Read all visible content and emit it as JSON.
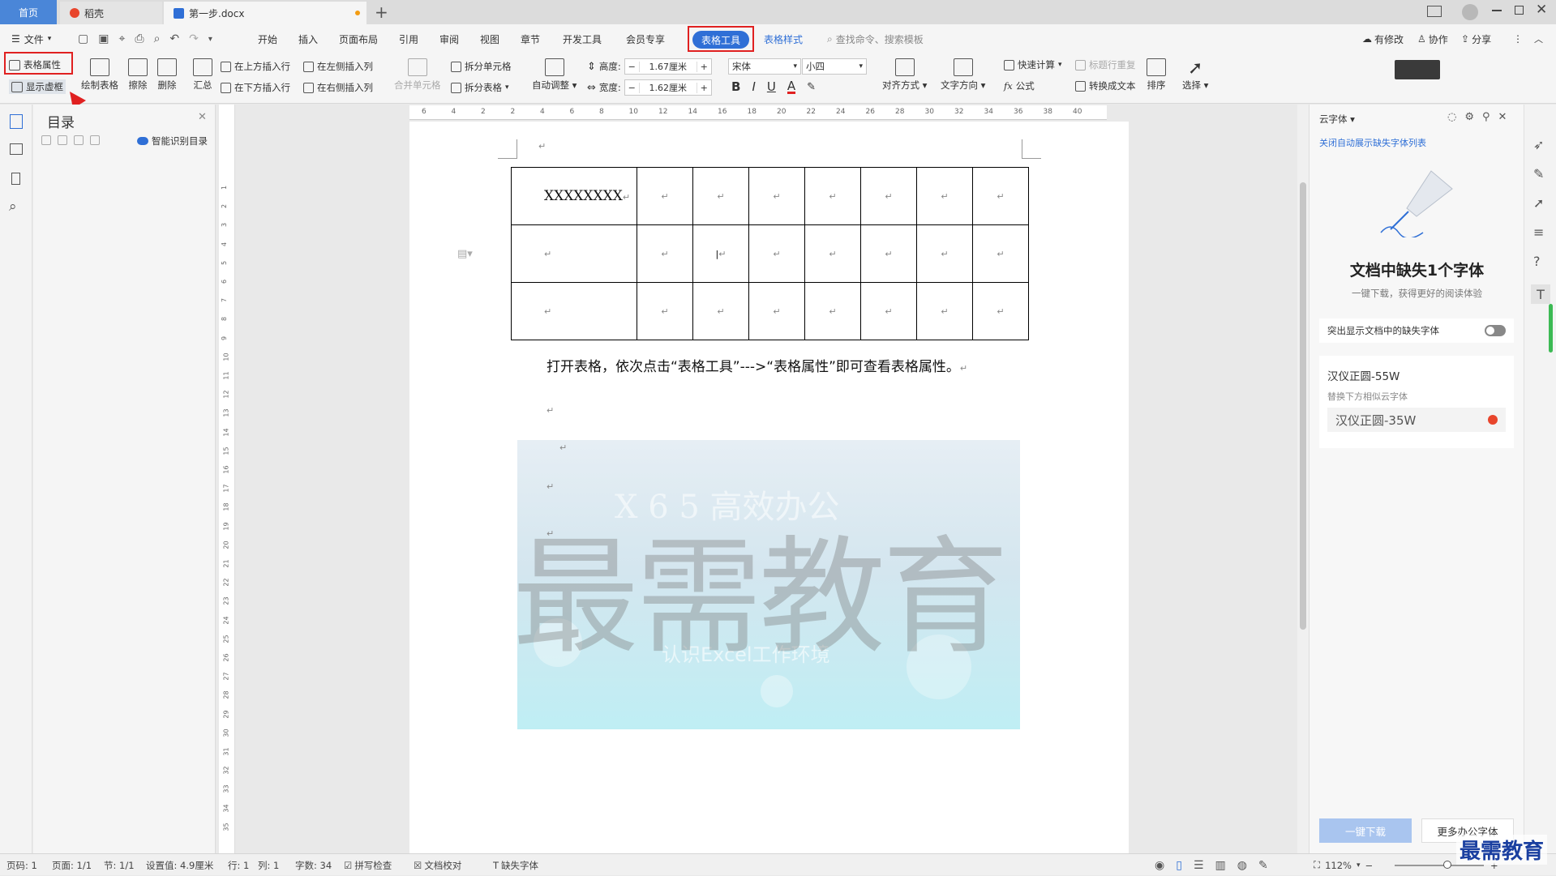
{
  "tabs": {
    "home": "首页",
    "t2": "稻壳",
    "t3": "第一步.docx",
    "add": "+"
  },
  "menu": {
    "file": "文件",
    "items": [
      "开始",
      "插入",
      "页面布局",
      "引用",
      "审阅",
      "视图",
      "章节",
      "开发工具",
      "会员专享"
    ],
    "active": "表格工具",
    "style": "表格样式",
    "search": "查找命令、搜索模板",
    "right": [
      "有修改",
      "协作",
      "分享"
    ]
  },
  "ribbon": {
    "table_props": "表格属性",
    "show_grid": "显示虚框",
    "draw": "绘制表格",
    "erase": "擦除",
    "delete": "删除",
    "sum": "汇总",
    "ins_above": "在上方插入行",
    "ins_left": "在左侧插入列",
    "ins_below": "在下方插入行",
    "ins_right": "在右侧插入列",
    "merge": "合并单元格",
    "split_cell": "拆分单元格",
    "split_table": "拆分表格",
    "auto_fit": "自动调整",
    "height_label": "高度:",
    "height_val": "1.67厘米",
    "width_label": "宽度:",
    "width_val": "1.62厘米",
    "font": "宋体",
    "size": "小四",
    "bold": "B",
    "italic": "I",
    "underline": "U",
    "fontcolor": "A",
    "align": "对齐方式",
    "text_dir": "文字方向",
    "quick_calc": "快速计算",
    "repeat_title": "标题行重复",
    "formula": "公式",
    "to_text": "转换成文本",
    "sort": "排序",
    "select": "选择"
  },
  "toc": {
    "title": "目录",
    "smart": "智能识别目录"
  },
  "ruler": {
    "h": [
      "6",
      "4",
      "2",
      "2",
      "4",
      "6",
      "8",
      "10",
      "12",
      "14",
      "16",
      "18",
      "20",
      "22",
      "24",
      "26",
      "28",
      "30",
      "32",
      "34",
      "36",
      "38",
      "40"
    ],
    "v": [
      "1",
      "2",
      "3",
      "4",
      "5",
      "6",
      "7",
      "8",
      "9",
      "10",
      "11",
      "12",
      "13",
      "14",
      "15",
      "16",
      "17",
      "18",
      "19",
      "20",
      "21",
      "22",
      "23",
      "24",
      "25",
      "26",
      "27",
      "28",
      "29",
      "30",
      "31",
      "32",
      "33",
      "34",
      "35"
    ]
  },
  "doc": {
    "cell1": "XXXXXXXX",
    "caption": "打开表格，依次点击“表格工具”--->“表格属性”即可查看表格属性。",
    "watermark": "最需教育",
    "banner_text1": "X 6 5  高效办公",
    "banner_text2": "认识Excel工作环境"
  },
  "cloud": {
    "title": "云字体",
    "hide": "关闭自动展示缺失字体列表",
    "heading": "文档中缺失1个字体",
    "sub": "一键下载，获得更好的阅读体验",
    "toggle": "突出显示文档中的缺失字体",
    "font_name": "汉仪正圆-55W",
    "replace_hint": "替换下方相似云字体",
    "replace_font": "汉仪正圆-35W",
    "download": "一键下载",
    "more": "更多办公字体"
  },
  "status": {
    "page": "页码: 1",
    "pages": "页面: 1/1",
    "section": "节: 1/1",
    "setting": "设置值: 4.9厘米",
    "row": "行: 1",
    "col": "列: 1",
    "words": "字数: 34",
    "spell": "拼写检查",
    "proof": "文档校对",
    "missing": "缺失字体",
    "zoom": "112%"
  },
  "logo": "最需教育",
  "colors": {
    "accent": "#2f6fd6",
    "red": "#e02020"
  }
}
